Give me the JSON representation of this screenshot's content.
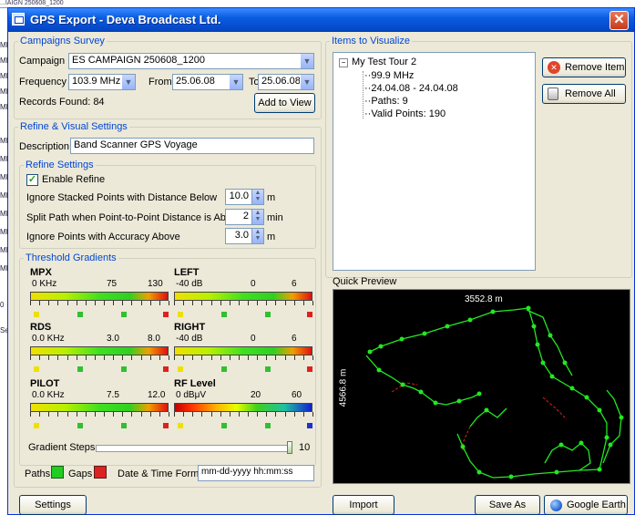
{
  "background": {
    "top_text": "...IAIGN 250608_1200",
    "mf_label": "MF",
    "se_label": "Se",
    "zero_label": "0"
  },
  "window": {
    "title": "GPS Export - Deva Broadcast Ltd.",
    "close": "✕"
  },
  "campaigns": {
    "legend": "Campaigns Survey",
    "campaign_label": "Campaign",
    "campaign_value": "ES CAMPAIGN 250608_1200",
    "frequency_label": "Frequency",
    "frequency_value": "103.9 MHz",
    "from_label": "From",
    "from_value": "25.06.08",
    "to_label": "To",
    "to_value": "25.06.08",
    "records_found": "Records Found: 84",
    "add_to_view": "Add to View"
  },
  "refine_visual": {
    "legend": "Refine & Visual Settings",
    "description_label": "Description",
    "description_value": "Band Scanner GPS Voyage",
    "refine_settings": {
      "legend": "Refine Settings",
      "enable_refine_label": "Enable Refine",
      "enable_refine_checked": true,
      "ignore_stacked_label": "Ignore Stacked Points with Distance Below",
      "ignore_stacked_value": "10.0",
      "ignore_stacked_unit": "m",
      "split_path_label": "Split Path when Point-to-Point Distance is Above",
      "split_path_value": "2",
      "split_path_unit": "min",
      "ignore_accuracy_label": "Ignore Points with Accuracy Above",
      "ignore_accuracy_value": "3.0",
      "ignore_accuracy_unit": "m"
    },
    "threshold": {
      "legend": "Threshold Gradients",
      "gauges": [
        {
          "name": "MPX",
          "scale": [
            "0 KHz",
            "75",
            "130"
          ]
        },
        {
          "name": "LEFT",
          "scale": [
            "-40 dB",
            "0",
            "6"
          ]
        },
        {
          "name": "RDS",
          "scale": [
            "0.0 KHz",
            "3.0",
            "8.0"
          ]
        },
        {
          "name": "RIGHT",
          "scale": [
            "-40 dB",
            "0",
            "6"
          ]
        },
        {
          "name": "PILOT",
          "scale": [
            "0.0 KHz",
            "7.5",
            "12.0"
          ]
        },
        {
          "name": "RF Level",
          "scale": [
            "0 dBμV",
            "20",
            "60"
          ]
        }
      ],
      "gradient_steps_label": "Gradient Steps",
      "gradient_steps_value": "10"
    },
    "paths_label": "Paths",
    "gaps_label": "Gaps",
    "date_time_label": "Date & Time Format",
    "date_time_value": "mm-dd-yyyy hh:mm:ss"
  },
  "items": {
    "legend": "Items to Visualize",
    "tree_root": "My Test Tour 2",
    "tree_children": [
      "99.9 MHz",
      "24.04.08 - 24.04.08",
      "Paths: 9",
      "Valid Points: 190"
    ],
    "remove_item": "Remove Item",
    "remove_all": "Remove All"
  },
  "preview": {
    "label": "Quick Preview",
    "width_text": "3552.8 m",
    "height_text": "4566.8 m"
  },
  "buttons": {
    "settings": "Settings",
    "import": "Import",
    "save_as": "Save As",
    "google_earth": "Google Earth"
  },
  "colors": {
    "title_bar": "#0a5de0",
    "legend_text": "#0046d5",
    "path_green": "#22e822",
    "gap_red": "#e02020",
    "paths_swatch": "#22cc22",
    "gaps_swatch": "#dd2222"
  }
}
